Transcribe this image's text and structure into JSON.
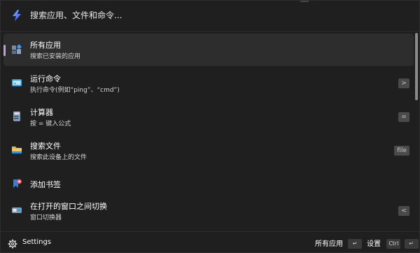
{
  "search": {
    "placeholder": "搜索应用、文件和命令..."
  },
  "results": [
    {
      "title": "所有应用",
      "subtitle": "搜索已安装的应用",
      "icon": "apps-icon",
      "selected": true,
      "badge": ""
    },
    {
      "title": "运行命令",
      "subtitle": "执行命令(例如“ping”、“cmd”)",
      "icon": "terminal-icon",
      "selected": false,
      "badge": ">"
    },
    {
      "title": "计算器",
      "subtitle": "按 = 键入公式",
      "icon": "calculator-icon",
      "selected": false,
      "badge": "="
    },
    {
      "title": "搜索文件",
      "subtitle": "搜索此设备上的文件",
      "icon": "folder-icon",
      "selected": false,
      "badge": "file"
    },
    {
      "title": "添加书签",
      "subtitle": "",
      "icon": "bookmark-add-icon",
      "selected": false,
      "badge": ""
    },
    {
      "title": "在打开的窗口之间切换",
      "subtitle": "窗口切换器",
      "icon": "window-switcher-icon",
      "selected": false,
      "badge": "<"
    }
  ],
  "footer": {
    "settings_label": "Settings",
    "primary_action_label": "所有应用",
    "primary_action_key": "↵",
    "secondary_action_label": "设置",
    "secondary_action_mod": "Ctrl",
    "secondary_action_key": "↵"
  },
  "colors": {
    "background": "#1f1f1f",
    "selected_row": "#2d2d2d",
    "accent": "#c79ae0"
  }
}
